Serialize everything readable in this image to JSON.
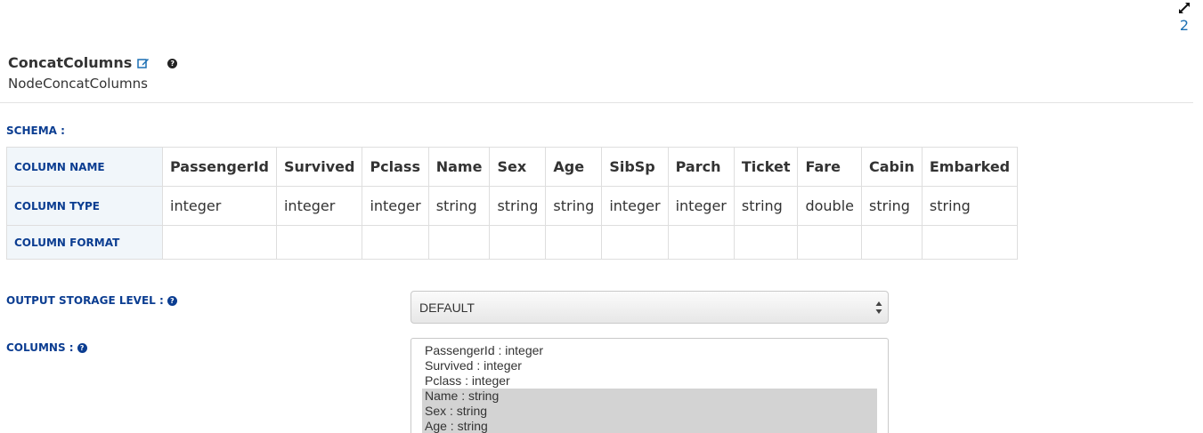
{
  "top": {
    "node_count": "2",
    "expand_icon": "expand-arrows-icon"
  },
  "header": {
    "title": "ConcatColumns",
    "subtitle": "NodeConcatColumns",
    "edit_icon": "edit-icon",
    "help_icon": "question-circle-icon"
  },
  "schema": {
    "label": "SCHEMA :",
    "row_labels": [
      "COLUMN NAME",
      "COLUMN TYPE",
      "COLUMN FORMAT"
    ],
    "columns": [
      {
        "name": "PassengerId",
        "type": "integer",
        "format": ""
      },
      {
        "name": "Survived",
        "type": "integer",
        "format": ""
      },
      {
        "name": "Pclass",
        "type": "integer",
        "format": ""
      },
      {
        "name": "Name",
        "type": "string",
        "format": ""
      },
      {
        "name": "Sex",
        "type": "string",
        "format": ""
      },
      {
        "name": "Age",
        "type": "string",
        "format": ""
      },
      {
        "name": "SibSp",
        "type": "integer",
        "format": ""
      },
      {
        "name": "Parch",
        "type": "integer",
        "format": ""
      },
      {
        "name": "Ticket",
        "type": "string",
        "format": ""
      },
      {
        "name": "Fare",
        "type": "double",
        "format": ""
      },
      {
        "name": "Cabin",
        "type": "string",
        "format": ""
      },
      {
        "name": "Embarked",
        "type": "string",
        "format": ""
      }
    ]
  },
  "storage": {
    "label": "OUTPUT STORAGE LEVEL :",
    "selected": "DEFAULT"
  },
  "columns_field": {
    "label": "COLUMNS :",
    "items": [
      {
        "text": "PassengerId : integer",
        "selected": false
      },
      {
        "text": "Survived : integer",
        "selected": false
      },
      {
        "text": "Pclass : integer",
        "selected": false
      },
      {
        "text": "Name : string",
        "selected": true
      },
      {
        "text": "Sex : string",
        "selected": true
      },
      {
        "text": "Age : string",
        "selected": true
      }
    ]
  },
  "colors": {
    "label_blue": "#0b3d91",
    "link_blue": "#1b6fb3",
    "row_head_bg": "#f1f6fa",
    "selected_bg": "#d3d3d3"
  }
}
